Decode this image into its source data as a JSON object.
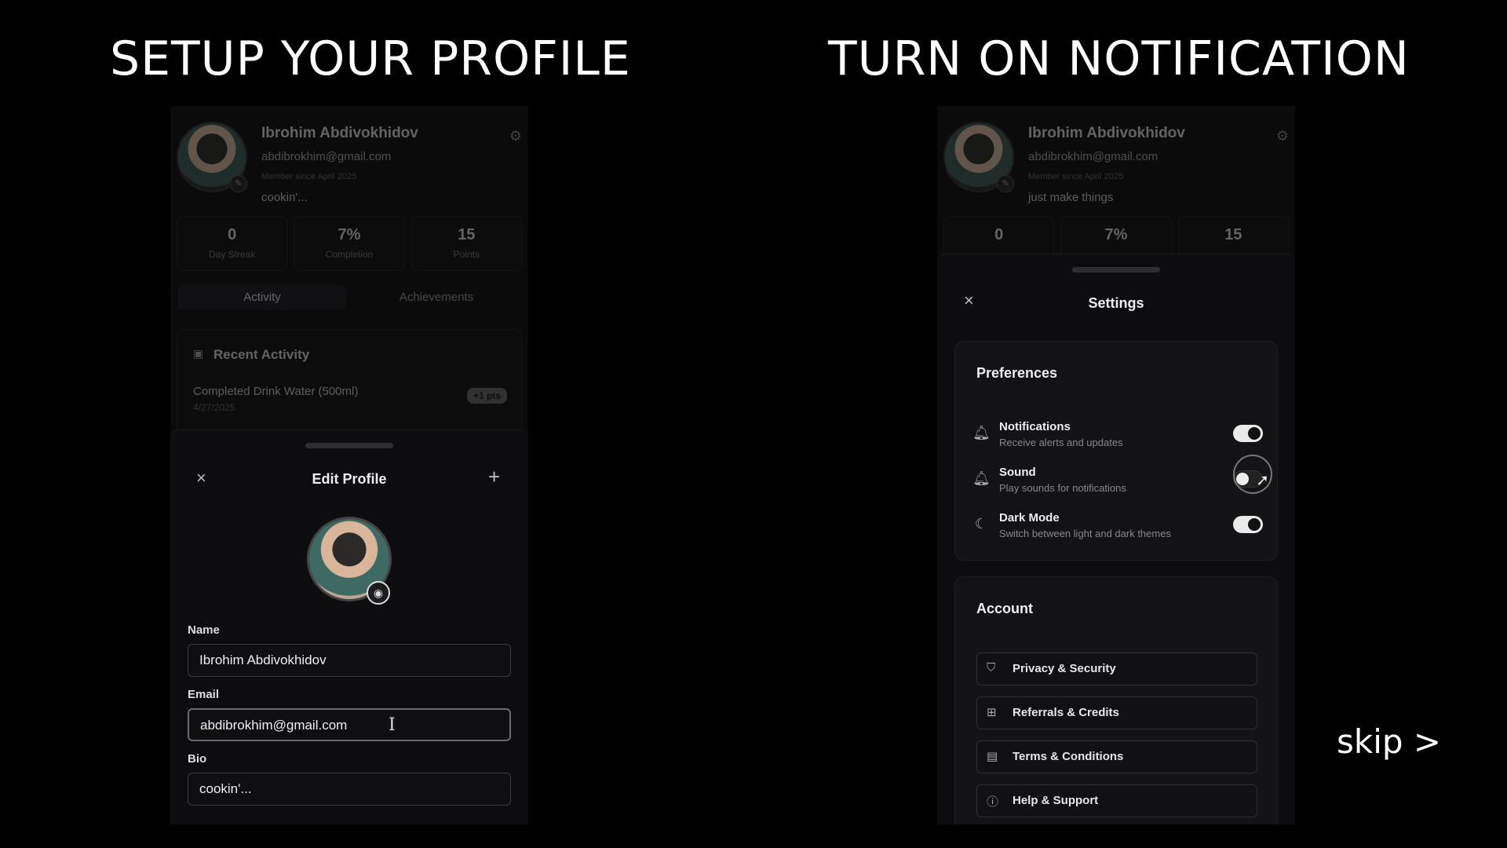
{
  "headings": {
    "left": "SETUP YOUR PROFILE",
    "right": "TURN ON NOTIFICATION"
  },
  "skip_label": "skip >",
  "left_screen": {
    "profile": {
      "name": "Ibrohim Abdivokhidov",
      "email": "abdibrokhim@gmail.com",
      "member_since": "Member since April 2025",
      "bio": "cookin'..."
    },
    "stats": [
      {
        "value": "0",
        "label": "Day Streak"
      },
      {
        "value": "7%",
        "label": "Completion"
      },
      {
        "value": "15",
        "label": "Points"
      }
    ],
    "tabs": [
      "Activity",
      "Achievements"
    ],
    "recent": {
      "title": "Recent Activity",
      "item": "Completed Drink Water (500ml)",
      "date": "4/27/2025",
      "badge": "+1 pts"
    },
    "edit_profile": {
      "title": "Edit Profile",
      "close_icon": "×",
      "add_icon": "+",
      "fields": {
        "name_label": "Name",
        "name_value": "Ibrohim Abdivokhidov",
        "email_label": "Email",
        "email_value": "abdibrokhim@gmail.com",
        "bio_label": "Bio",
        "bio_value": "cookin'..."
      }
    }
  },
  "right_screen": {
    "profile": {
      "name": "Ibrohim Abdivokhidov",
      "email": "abdibrokhim@gmail.com",
      "member_since": "Member since April 2025",
      "bio": "just make things"
    },
    "stats": [
      "0",
      "7%",
      "15"
    ],
    "settings": {
      "title": "Settings",
      "close_icon": "×",
      "preferences": {
        "title": "Preferences",
        "rows": [
          {
            "title": "Notifications",
            "desc": "Receive alerts and updates",
            "icon": "bell-icon",
            "on": true
          },
          {
            "title": "Sound",
            "desc": "Play sounds for notifications",
            "icon": "bell-icon",
            "on": false
          },
          {
            "title": "Dark Mode",
            "desc": "Switch between light and dark themes",
            "icon": "moon-icon",
            "on": true
          }
        ]
      },
      "account": {
        "title": "Account",
        "items": [
          {
            "label": "Privacy & Security",
            "icon": "shield-icon"
          },
          {
            "label": "Referrals & Credits",
            "icon": "gift-icon"
          },
          {
            "label": "Terms & Conditions",
            "icon": "document-icon"
          },
          {
            "label": "Help & Support",
            "icon": "help-icon"
          }
        ]
      }
    }
  }
}
